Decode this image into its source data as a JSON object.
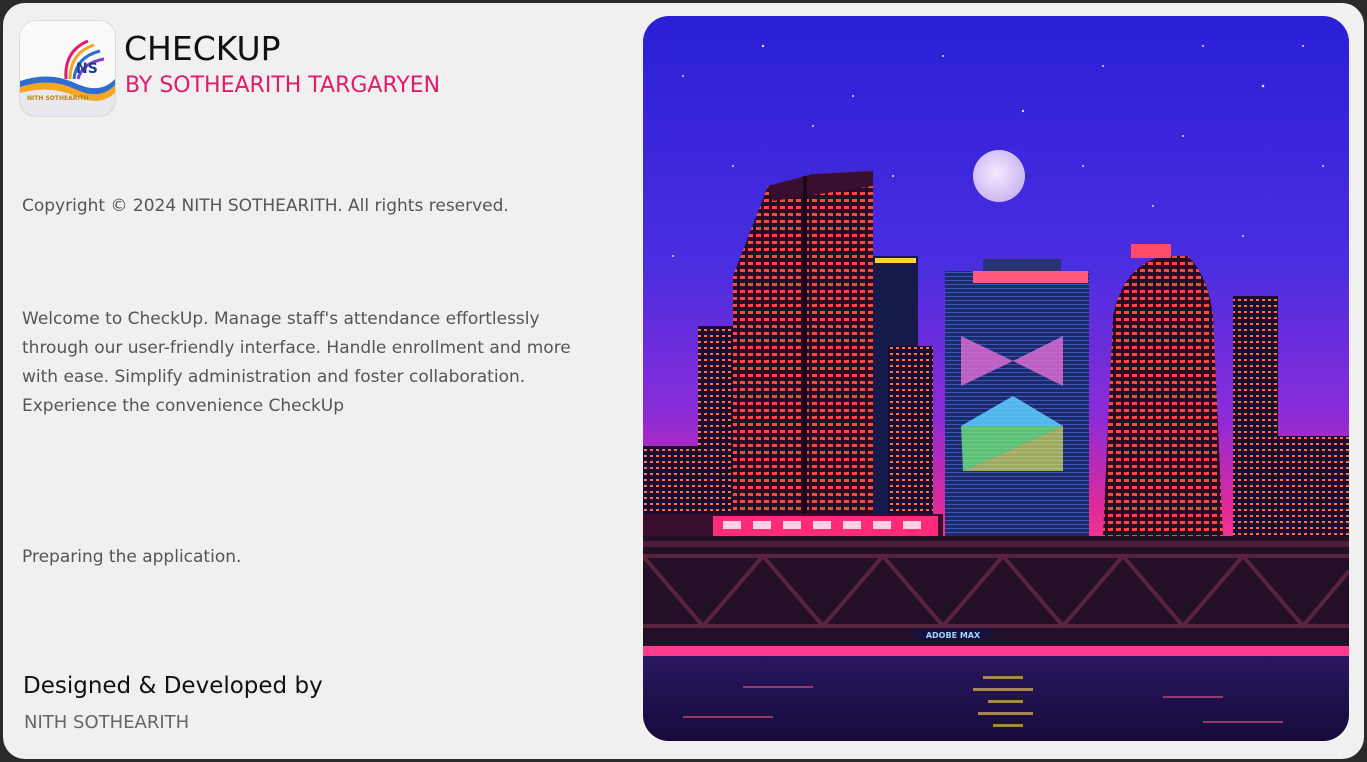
{
  "app": {
    "title": "CHECKUP",
    "subtitle": "BY SOTHEARITH TARGARYEN",
    "logo_text": "NITH SOTHEARITH",
    "logo_initials": "NS"
  },
  "copyright": "Copyright © 2024 NITH SOTHEARITH. All rights reserved.",
  "welcome": "Welcome to CheckUp. Manage staff's attendance effortlessly through our user-friendly interface. Handle enrollment and more with ease. Simplify administration and foster collaboration. Experience the convenience CheckUp",
  "status": "Preparing the application.",
  "credits": {
    "heading": "Designed & Developed by",
    "name": "NITH SOTHEARITH"
  },
  "hero": {
    "sign_text": "ADOBE MAX"
  },
  "colors": {
    "accent": "#e5196b",
    "background": "#f0f0f0"
  }
}
